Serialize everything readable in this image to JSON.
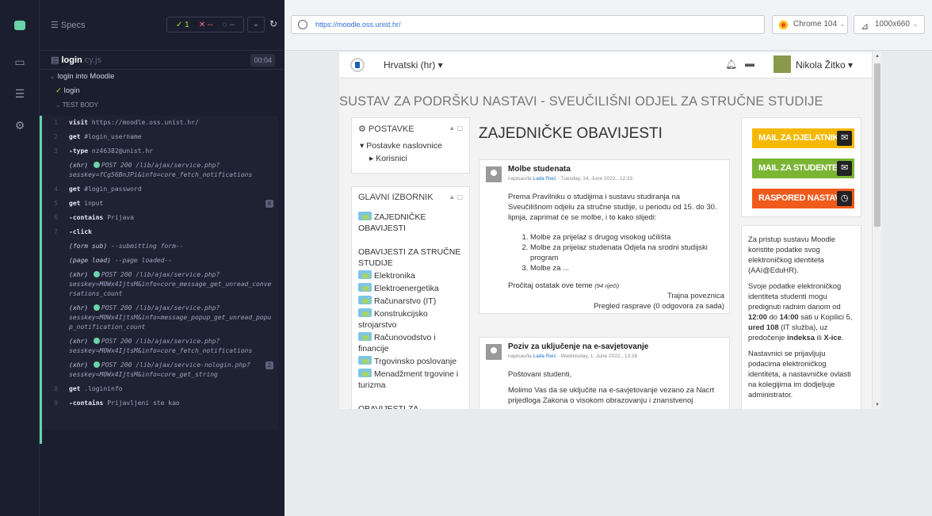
{
  "reporter": {
    "specs_label": "Specs",
    "passed": "1",
    "failed": "--",
    "pending": "--",
    "file_name": "login",
    "file_ext": ".cy.js",
    "duration": "00:04",
    "suite": "login into Moodle",
    "test": "login",
    "section": "TEST BODY",
    "commands": [
      {
        "n": "1",
        "name": "visit",
        "msg": "https://moodle.oss.unist.hr/"
      },
      {
        "n": "2",
        "name": "get",
        "msg": "#login_username"
      },
      {
        "n": "3",
        "name": "-type",
        "msg": "nz46382@unist.hr"
      },
      {
        "n": "",
        "name": "(xhr)",
        "msg": "POST 200 /lib/ajax/service.php?",
        "msg2": "sesskey=fCg56BnJPi&info=core_fetch_notifications"
      },
      {
        "n": "4",
        "name": "get",
        "msg": "#login_password"
      },
      {
        "n": "5",
        "name": "get",
        "msg": "input",
        "badge": "8"
      },
      {
        "n": "6",
        "name": "-contains",
        "msg": "Prijava"
      },
      {
        "n": "7",
        "name": "-click",
        "msg": ""
      },
      {
        "n": "",
        "name": "(form sub)",
        "msg": "--submitting form--"
      },
      {
        "n": "",
        "name": "(page load)",
        "msg": "--page loaded--"
      },
      {
        "n": "",
        "name": "(xhr)",
        "msg": "POST 200 /lib/ajax/service.php?",
        "msg2": "sesskey=M0Wx4IjtsM&info=core_message_get_unread_conve",
        "msg3": "rsations_count"
      },
      {
        "n": "",
        "name": "(xhr)",
        "msg": "POST 200 /lib/ajax/service.php?",
        "msg2": "sesskey=M0Wx4IjtsM&info=message_popup_get_unread_popu",
        "msg3": "p_notification_count"
      },
      {
        "n": "",
        "name": "(xhr)",
        "msg": "POST 200 /lib/ajax/service.php?",
        "msg2": "sesskey=M0Wx4IjtsM&info=core_fetch_notifications"
      },
      {
        "n": "",
        "name": "(xhr)",
        "msg": "POST 200 /lib/ajax/service-nologin.php?",
        "msg2": "sesskey=M0Wx4IjtsM&info=core_get_string",
        "badge": "2"
      },
      {
        "n": "8",
        "name": "get",
        "msg": ".logininfo"
      },
      {
        "n": "9",
        "name": "-contains",
        "msg": "Prijavljeni ste kao"
      }
    ]
  },
  "browser": {
    "url": "https://moodle.oss.unist.hr/",
    "browser_label": "Chrome 104",
    "viewport_label": "1000x660"
  },
  "moodle": {
    "language": "Hrvatski (hr)",
    "user_name": "Nikola Žitko",
    "site_title": "SUSTAV ZA PODRŠKU NASTAVI - SVEUČILIŠNI ODJEL ZA STRUČNE STUDIJE",
    "settings_block": {
      "title": "POSTAVKE",
      "item1": "Postavke naslovnice",
      "item2": "Korisnici"
    },
    "main_menu": {
      "title": "GLAVNI IZBORNIK",
      "top_link": "ZAJEDNIČKE OBAVIJESTI",
      "group1": "OBAVIJESTI ZA STRUČNE STUDIJE",
      "items": [
        "Elektronika",
        "Elektroenergetika",
        "Računarstvo (IT)",
        "Konstrukcijsko strojarstvo",
        "Računovodstvo i financije",
        "Trgovinsko poslovanje",
        "Menadžment trgovine i turizma"
      ],
      "group2": "OBAVIJESTI ZA SPECIJALISTIČKE STUDIJE"
    },
    "news_heading": "ZAJEDNIČKE OBAVIJESTI",
    "post1": {
      "title": "Molbe studenata",
      "meta_prefix": "napisao/la",
      "author": "Lada Reić",
      "date": "- Tuesday, 14. June 2022., 12:33",
      "intro": "Prema Pravilniku o studijima i sustavu studiranja na Sveučilišnom odjelu za stručne studije, u periodu od 15. do 30. lipnja, zaprimat će se molbe, i to kako slijedi:",
      "list": [
        "Molbe za prijelaz s drugog visokog učilišta",
        "Molbe za prijelaz studenata Odjela na srodni studijski program",
        "Molbe za ..."
      ],
      "read_more": "Pročitaj ostatak ove teme",
      "word_count": "(94 riječi)",
      "permalink": "Trajna poveznica",
      "discussion": "Pregled rasprave (0 odgovora za sada)"
    },
    "post2": {
      "title": "Poziv za uključenje na e-savjetovanje",
      "meta_prefix": "napisao/la",
      "author": "Lada Reić",
      "date": "- Wednesday, 1. June 2022., 13:28",
      "greeting": "Poštovani studenti,",
      "body": "Molimo Vas da se uključite na e-savjetovanje vezano za Nacrt prijedloga Zakona o visokom obrazovanju i znanstvenoj"
    },
    "buttons": [
      {
        "label": "MAIL ZA DJELATNIKE",
        "color": "#f5b800",
        "icon": "envelope-icon",
        "glyph": "✉"
      },
      {
        "label": "MAIL ZA STUDENTE",
        "color": "#7ab534",
        "icon": "envelope-icon",
        "glyph": "✉"
      },
      {
        "label": "RASPORED NASTAVE",
        "color": "#f05a1a",
        "icon": "clock-icon",
        "glyph": "◷"
      }
    ],
    "info": {
      "p1": "Za pristup sustavu Moodle koristite podatke svog elektroničkog identiteta (AAI@EduHR).",
      "p2a": "Svoje podatke elektroničkog identiteta studenti mogu predignuti radnim danom od",
      "p2b": "12:00",
      "p2c": "do",
      "p2d": "14:00",
      "p2e": "sati u Kopilici",
      "p2f": "5,",
      "p2g": "ured 108",
      "p2h": "(IT služba), uz predočenje",
      "p2i": "indeksa",
      "p2j": "ili",
      "p2k": "X-ice",
      "p3": "Nastavnici se prijavljuju podacima elektroničkog identiteta, a nastavničke ovlasti na kolegijima im dodjeljuje administrator."
    }
  },
  "colors": {
    "accent": "#69d3a7",
    "reporter_bg": "#1b1e2e",
    "link": "#1a73c6"
  }
}
